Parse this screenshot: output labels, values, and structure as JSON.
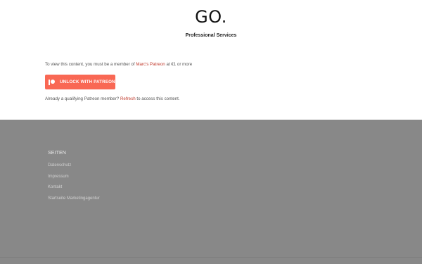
{
  "header": {
    "logo": "GO.",
    "tagline": "Professional Services"
  },
  "content": {
    "notice_prefix": "To view this content, you must be a member of ",
    "notice_link": "Marc's Patreon",
    "notice_suffix": " at €1 or more",
    "button_label": "UNLOCK WITH PATREON",
    "button_icon": "patreon-icon",
    "refresh_prefix": "Already a qualifying Patreon member? ",
    "refresh_link": "Refresh",
    "refresh_suffix": " to access this content."
  },
  "footer": {
    "heading": "SEITEN",
    "links": [
      {
        "label": "Datenschutz"
      },
      {
        "label": "Impressum"
      },
      {
        "label": "Kontakt"
      },
      {
        "label": "Startseite Marketingagentur"
      }
    ]
  },
  "colors": {
    "accent": "#c1392b",
    "patreon": "#f96854",
    "footer_bg": "#888888"
  }
}
